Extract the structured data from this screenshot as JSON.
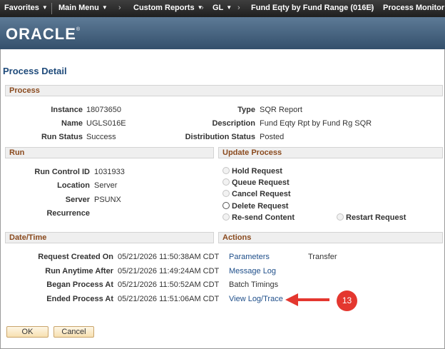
{
  "nav": {
    "favorites": "Favorites",
    "main_menu": "Main Menu",
    "breadcrumbs": [
      "Custom Reports",
      "GL",
      "Fund Eqty by Fund Range (016E)",
      "Process Monitor"
    ]
  },
  "brand": {
    "logo": "ORACLE",
    "reg": "®"
  },
  "page_title": "Process Detail",
  "process": {
    "header": "Process",
    "instance_label": "Instance",
    "instance": "18073650",
    "name_label": "Name",
    "name": "UGLS016E",
    "run_status_label": "Run Status",
    "run_status": "Success",
    "type_label": "Type",
    "type": "SQR Report",
    "description_label": "Description",
    "description": "Fund Eqty Rpt by Fund Rg SQR",
    "distribution_status_label": "Distribution Status",
    "distribution_status": "Posted"
  },
  "run": {
    "header": "Run",
    "run_control_id_label": "Run Control ID",
    "run_control_id": "1031933",
    "location_label": "Location",
    "location": "Server",
    "server_label": "Server",
    "server": "PSUNX",
    "recurrence_label": "Recurrence",
    "recurrence": ""
  },
  "update_process": {
    "header": "Update Process",
    "options": [
      "Hold Request",
      "Queue Request",
      "Cancel Request",
      "Delete Request",
      "Re-send Content",
      "Restart Request"
    ],
    "selected": null
  },
  "datetime": {
    "header": "Date/Time",
    "request_created_label": "Request Created On",
    "request_created": "05/21/2026 11:50:38AM CDT",
    "run_anytime_label": "Run Anytime After",
    "run_anytime": "05/21/2026 11:49:24AM CDT",
    "began_label": "Began Process At",
    "began": "05/21/2026 11:50:52AM CDT",
    "ended_label": "Ended Process At",
    "ended": "05/21/2026 11:51:06AM CDT"
  },
  "actions": {
    "header": "Actions",
    "parameters": "Parameters",
    "transfer": "Transfer",
    "message_log": "Message Log",
    "batch_timings": "Batch Timings",
    "view_log_trace": "View Log/Trace"
  },
  "buttons": {
    "ok": "OK",
    "cancel": "Cancel"
  },
  "callout": {
    "number": "13",
    "color": "#e4372f"
  },
  "colors": {
    "link": "#1f4f8a",
    "section_header_text": "#8a4a1e",
    "title": "#1e4a7a"
  }
}
